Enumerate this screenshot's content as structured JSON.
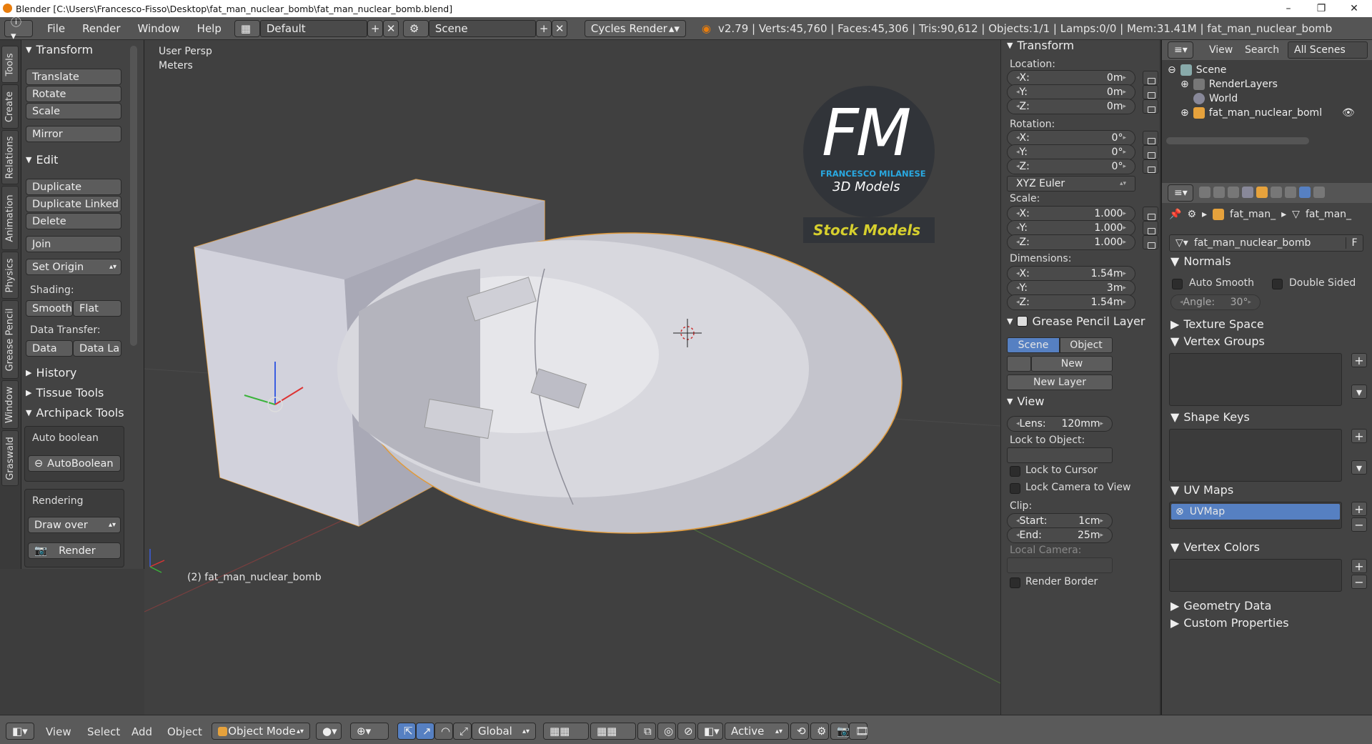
{
  "window": {
    "title": "Blender [C:\\Users\\Francesco-Fisso\\Desktop\\fat_man_nuclear_bomb\\fat_man_nuclear_bomb.blend]",
    "min": "–",
    "max": "❐",
    "close": "✕"
  },
  "infobar": {
    "menus": [
      "File",
      "Render",
      "Window",
      "Help"
    ],
    "layout": "Default",
    "scene": "Scene",
    "engine": "Cycles Render",
    "stats": "v2.79 | Verts:45,760 | Faces:45,306 | Tris:90,612 | Objects:1/1 | Lamps:0/0 | Mem:31.41M | fat_man_nuclear_bomb"
  },
  "lefttabs": [
    "Tools",
    "Create",
    "Relations",
    "Animation",
    "Physics",
    "Grease Pencil",
    "Window",
    "Graswald"
  ],
  "toolshelf": {
    "transform_header": "Transform",
    "translate": "Translate",
    "rotate": "Rotate",
    "scale": "Scale",
    "mirror": "Mirror",
    "edit_header": "Edit",
    "duplicate": "Duplicate",
    "duplicate_linked": "Duplicate Linked",
    "delete": "Delete",
    "join": "Join",
    "set_origin": "Set Origin",
    "shading_label": "Shading:",
    "smooth": "Smooth",
    "flat": "Flat",
    "data_transfer_label": "Data Transfer:",
    "data": "Data",
    "data_la": "Data La",
    "history_header": "History",
    "tissue_header": "Tissue Tools",
    "archipack_header": "Archipack Tools",
    "auto_boolean_label": "Auto boolean",
    "autoboolean_btn": "AutoBoolean",
    "rendering_label": "Rendering",
    "draw_over": "Draw over",
    "render_btn": "Render"
  },
  "viewport": {
    "view_name": "User Persp",
    "units": "Meters",
    "object_label": "(2) fat_man_nuclear_bomb",
    "logo_fm": "FM",
    "logo_name": "FRANCESCO MILANESE",
    "logo_sub": "3D Models",
    "logo_stock": "Stock Models",
    "logo_fm_color": "#29a8e0",
    "stock_color": "#d6cf2e"
  },
  "npanel": {
    "transform_header": "Transform",
    "location_label": "Location:",
    "loc": [
      {
        "axis": "X:",
        "val": "0m"
      },
      {
        "axis": "Y:",
        "val": "0m"
      },
      {
        "axis": "Z:",
        "val": "0m"
      }
    ],
    "rotation_label": "Rotation:",
    "rot": [
      {
        "axis": "X:",
        "val": "0°"
      },
      {
        "axis": "Y:",
        "val": "0°"
      },
      {
        "axis": "Z:",
        "val": "0°"
      }
    ],
    "euler": "XYZ Euler",
    "scale_label": "Scale:",
    "scl": [
      {
        "axis": "X:",
        "val": "1.000"
      },
      {
        "axis": "Y:",
        "val": "1.000"
      },
      {
        "axis": "Z:",
        "val": "1.000"
      }
    ],
    "dimensions_label": "Dimensions:",
    "dim": [
      {
        "axis": "X:",
        "val": "1.54m"
      },
      {
        "axis": "Y:",
        "val": "3m"
      },
      {
        "axis": "Z:",
        "val": "1.54m"
      }
    ],
    "gp_header": "Grease Pencil Layer",
    "gp_scene": "Scene",
    "gp_object": "Object",
    "gp_new": "New",
    "gp_new_layer": "New Layer",
    "view_header": "View",
    "lens_label": "Lens:",
    "lens_val": "120mm",
    "lock_obj_label": "Lock to Object:",
    "lock_cursor": "Lock to Cursor",
    "lock_camera": "Lock Camera to View",
    "clip_label": "Clip:",
    "start_label": "Start:",
    "start_val": "1cm",
    "end_label": "End:",
    "end_val": "25m",
    "local_camera": "Local Camera:",
    "render_border": "Render Border"
  },
  "outliner": {
    "tabs": [
      "View",
      "Search",
      "All Scenes"
    ],
    "items": [
      "Scene",
      "RenderLayers",
      "World",
      "fat_man_nuclear_boml"
    ]
  },
  "props": {
    "crumb1": "fat_man_",
    "crumb2": "fat_man_",
    "mesh_name": "fat_man_nuclear_bomb",
    "fake_user": "F",
    "normals": "Normals",
    "auto_smooth": "Auto Smooth",
    "double_sided": "Double Sided",
    "angle_label": "Angle:",
    "angle_val": "30°",
    "texture_space": "Texture Space",
    "vertex_groups": "Vertex Groups",
    "shape_keys": "Shape Keys",
    "uv_maps": "UV Maps",
    "uvmap": "UVMap",
    "vertex_colors": "Vertex Colors",
    "geometry_data": "Geometry Data",
    "custom_props": "Custom Properties"
  },
  "bottombar": {
    "menus": [
      "View",
      "Select",
      "Add",
      "Object"
    ],
    "mode": "Object Mode",
    "orientation": "Global",
    "pivot": "Active"
  }
}
